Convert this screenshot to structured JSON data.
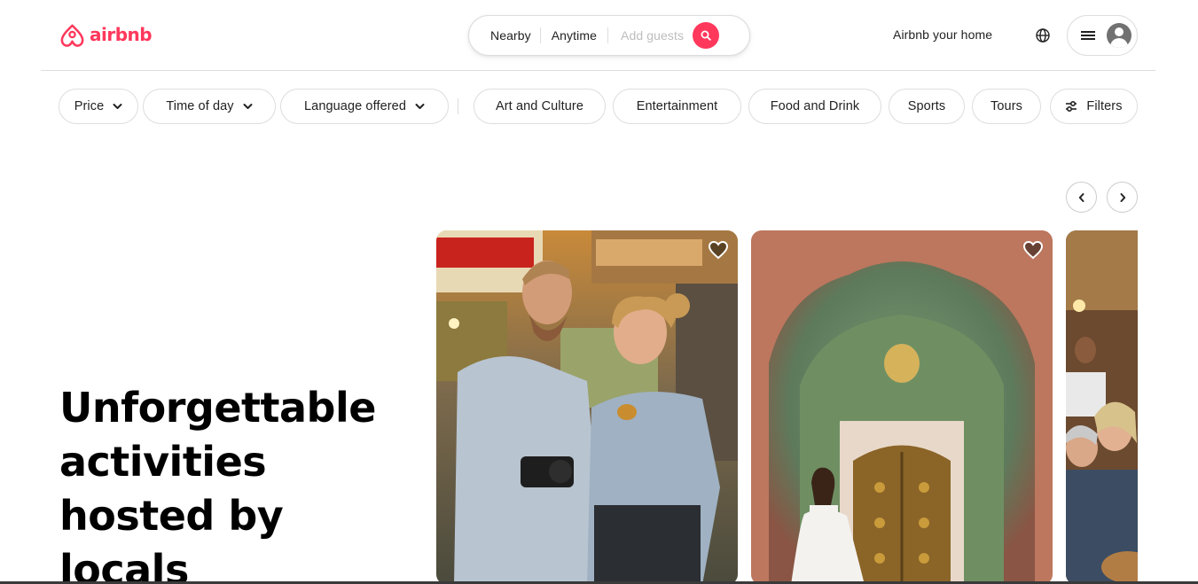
{
  "colors": {
    "brand": "#ff385c",
    "text": "#222222",
    "border": "#dddddd",
    "placeholder": "#bdbdbd"
  },
  "header": {
    "logo_text": "airbnb",
    "logo_icon": "airbnb-belo-icon",
    "search": {
      "location": "Nearby",
      "dates": "Anytime",
      "guests_placeholder": "Add guests",
      "search_icon": "search-icon"
    },
    "host_link": "Airbnb your home",
    "globe_icon": "globe-icon",
    "menu_icon": "hamburger-menu-icon",
    "avatar_icon": "user-avatar-icon"
  },
  "filters": {
    "dropdowns": [
      {
        "label": "Price"
      },
      {
        "label": "Time of day"
      },
      {
        "label": "Language offered"
      }
    ],
    "categories": [
      "Art and Culture",
      "Entertainment",
      "Food and Drink",
      "Sports",
      "Tours"
    ],
    "filters_button": "Filters",
    "filters_icon": "sliders-icon"
  },
  "carousel": {
    "prev_icon": "chevron-left-icon",
    "next_icon": "chevron-right-icon"
  },
  "hero": {
    "lines": [
      "Unforgettable",
      "activities",
      "hosted by",
      "locals"
    ]
  },
  "cards": [
    {
      "image": "Two people tasting street food in a busy market",
      "wishlist_icon": "heart-icon"
    },
    {
      "image": "Woman in white dress before an ornate painted palace doorway",
      "wishlist_icon": "heart-icon"
    },
    {
      "image": "Group sharing a meal at a food stall",
      "wishlist_icon": "heart-icon"
    }
  ]
}
